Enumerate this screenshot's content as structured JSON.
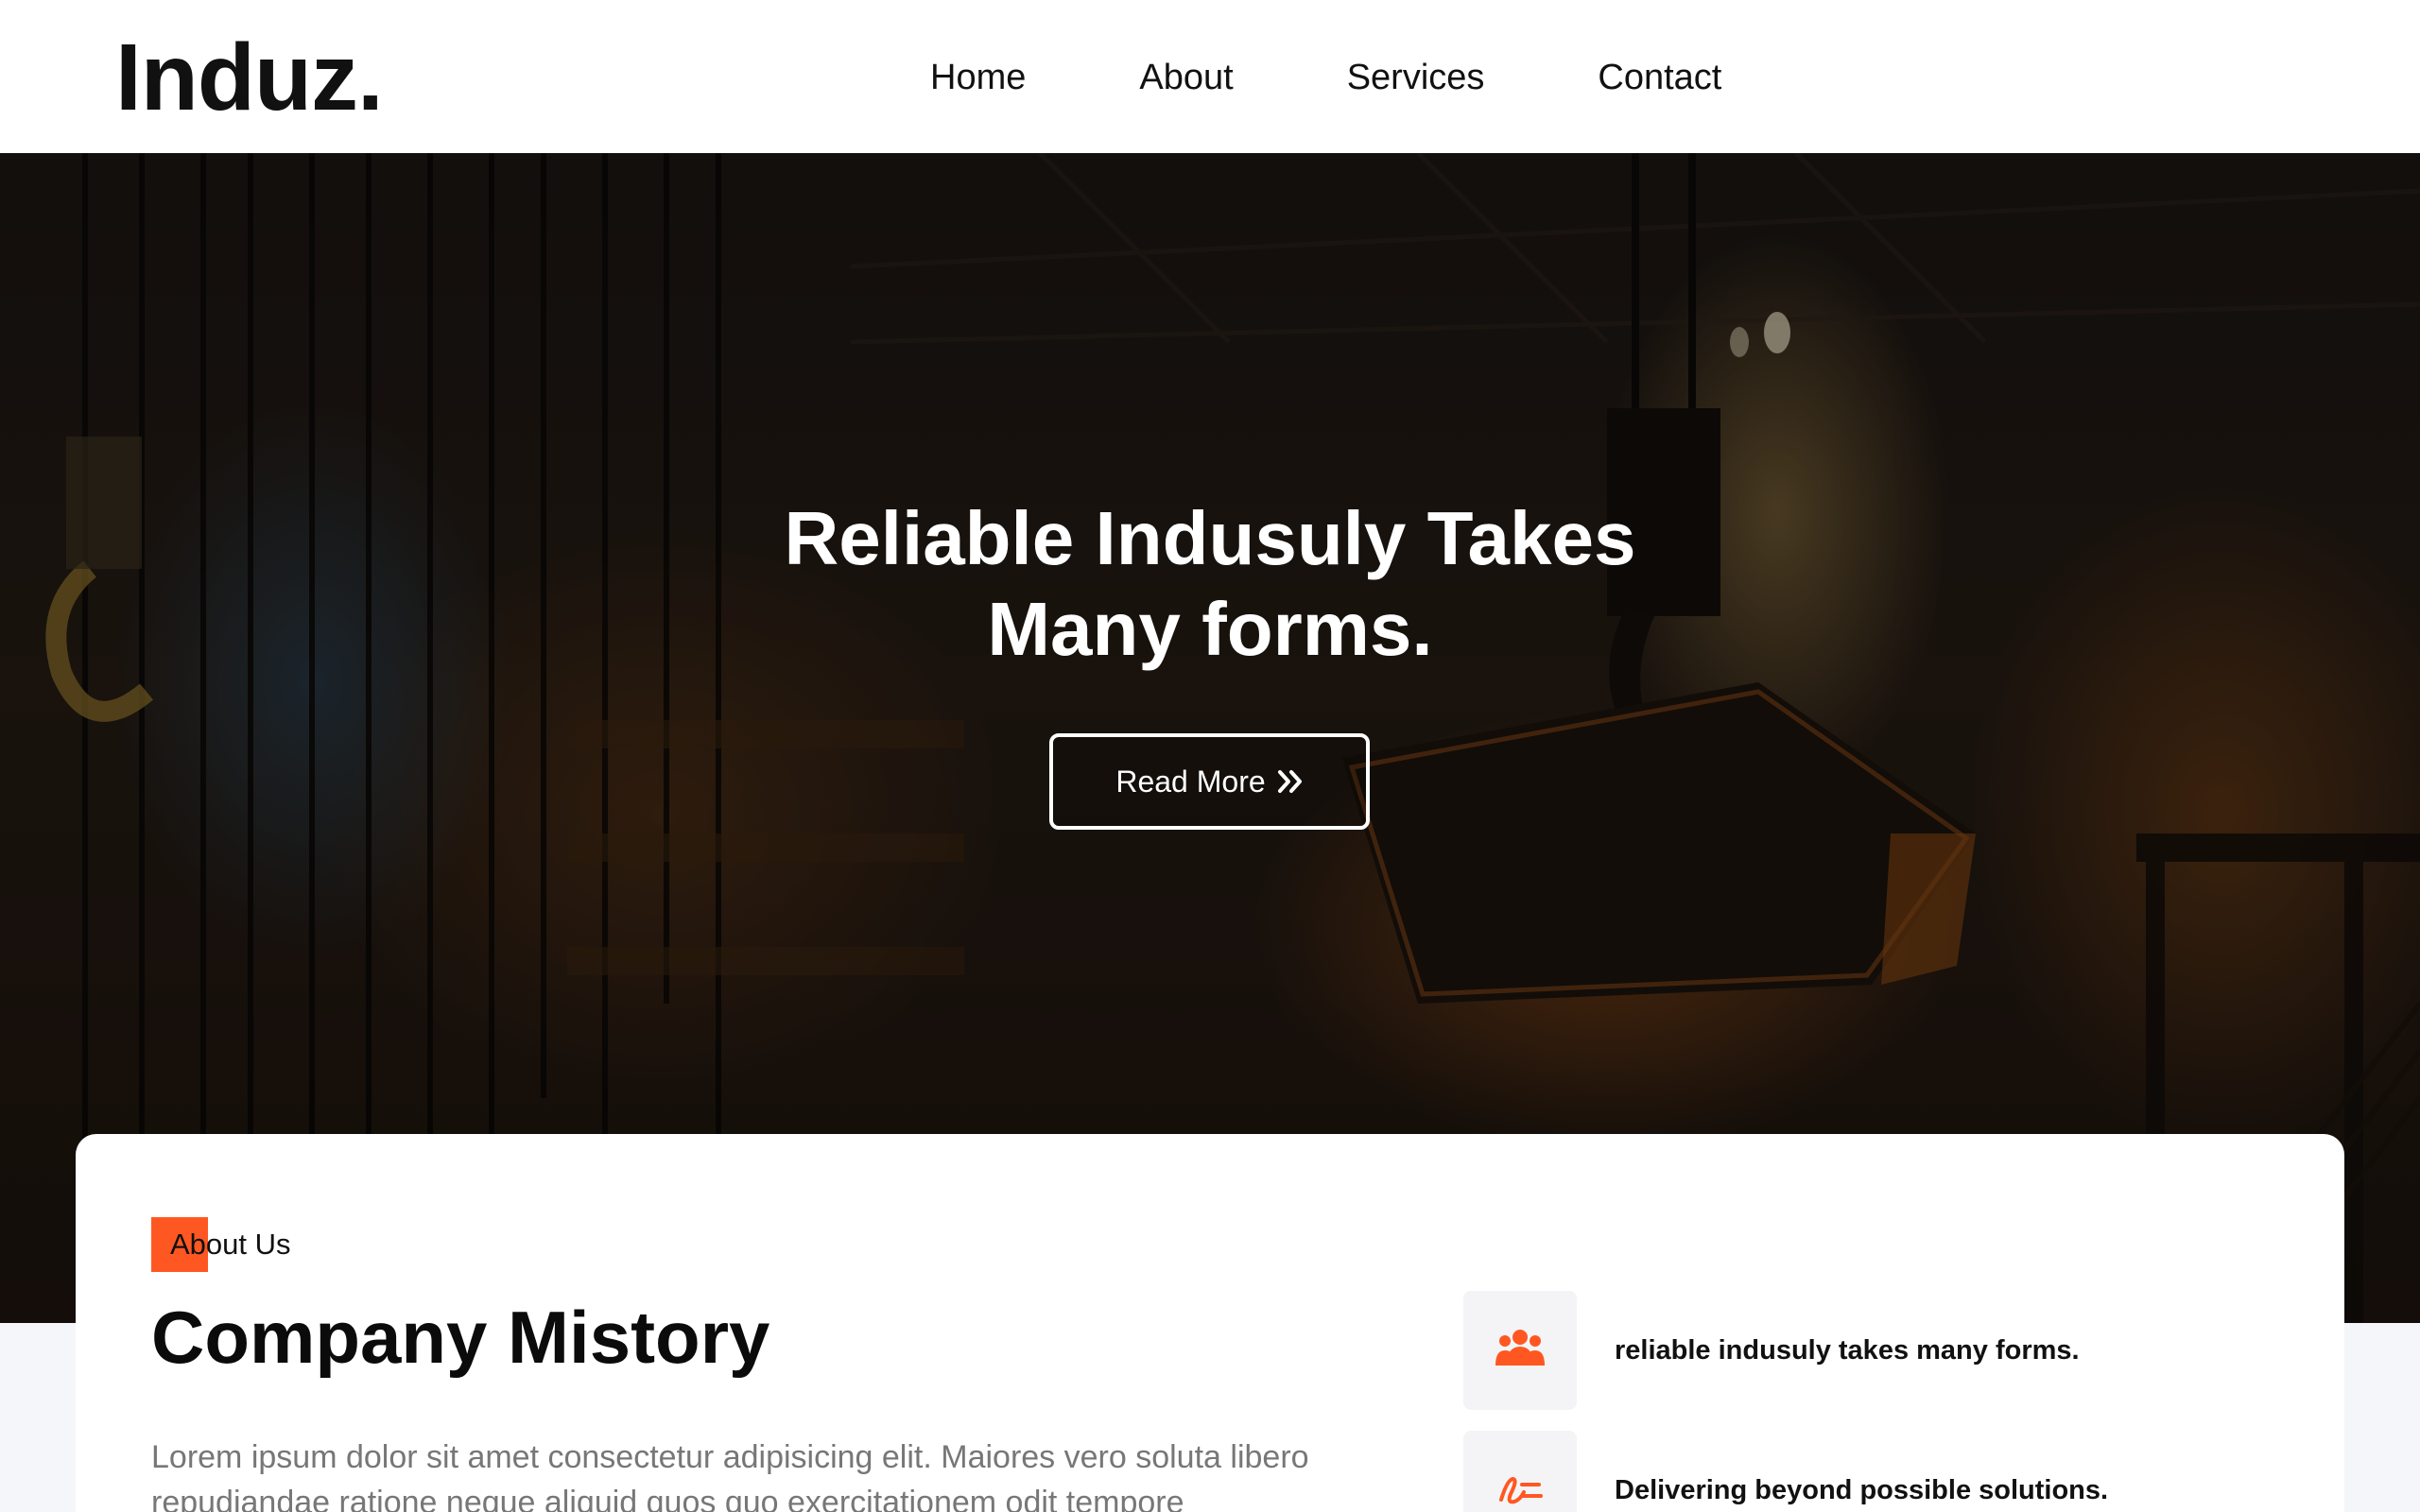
{
  "brand": {
    "logo": "Induz."
  },
  "nav": {
    "items": [
      {
        "label": "Home"
      },
      {
        "label": "About"
      },
      {
        "label": "Services"
      },
      {
        "label": "Contact"
      }
    ]
  },
  "hero": {
    "title_line1": "Reliable Indusuly Takes",
    "title_line2": "Many forms.",
    "button_label": "Read More",
    "button_icon": "double-chevron-right-icon",
    "background": "industrial foundry with crane ladle"
  },
  "about": {
    "tag": "About Us",
    "title": "Company Mistory",
    "text": "Lorem ipsum dolor sit amet consectetur adipisicing elit. Maiores vero soluta libero repudiandae ratione neque aliquid quos quo exercitationem odit tempore",
    "features": [
      {
        "icon": "users-icon",
        "text": "reliable indusuly takes many forms."
      },
      {
        "icon": "signature-icon",
        "text": "Delivering beyond possible solutions."
      }
    ]
  },
  "colors": {
    "accent": "#ff5722",
    "text_dark": "#111111",
    "text_muted": "#777777",
    "header_bg": "#ffffff",
    "page_bg": "#f5f6fa"
  }
}
